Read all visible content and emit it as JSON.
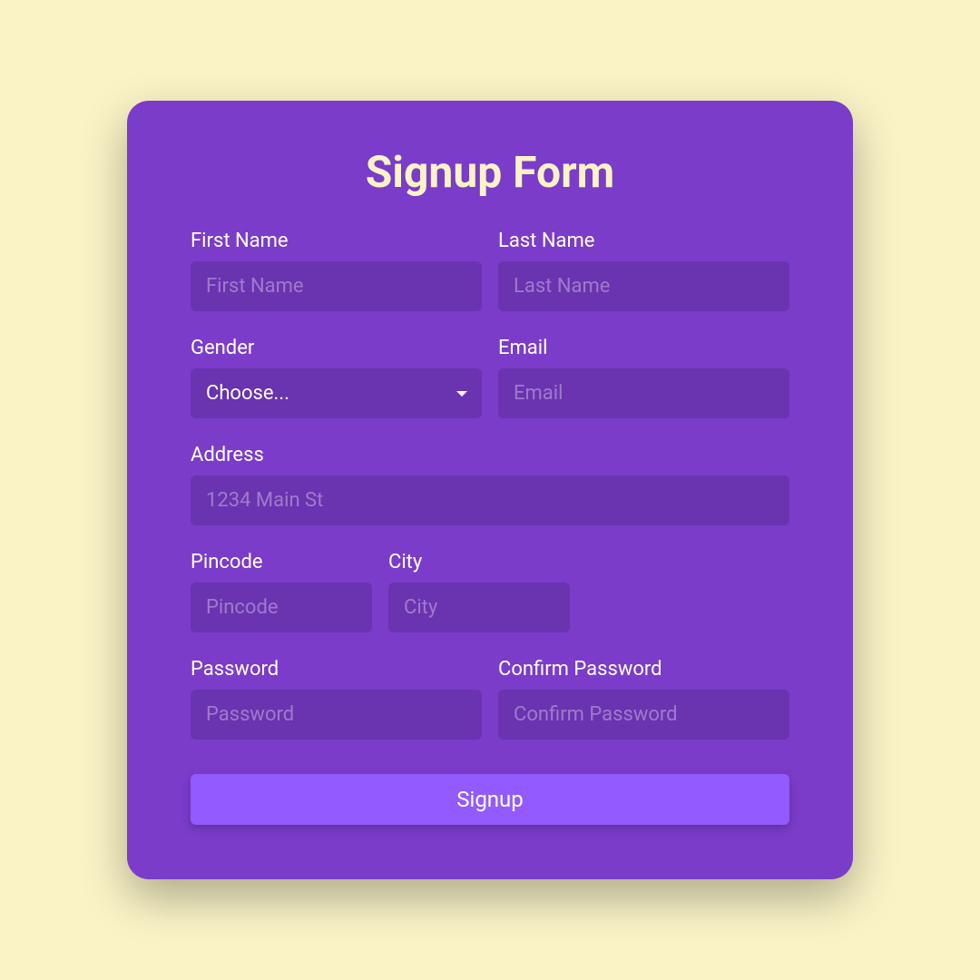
{
  "form": {
    "title": "Signup Form",
    "firstName": {
      "label": "First Name",
      "placeholder": "First Name",
      "value": ""
    },
    "lastName": {
      "label": "Last Name",
      "placeholder": "Last Name",
      "value": ""
    },
    "gender": {
      "label": "Gender",
      "selected": "Choose..."
    },
    "email": {
      "label": "Email",
      "placeholder": "Email",
      "value": ""
    },
    "address": {
      "label": "Address",
      "placeholder": "1234 Main St",
      "value": ""
    },
    "pincode": {
      "label": "Pincode",
      "placeholder": "Pincode",
      "value": ""
    },
    "city": {
      "label": "City",
      "placeholder": "City",
      "value": ""
    },
    "password": {
      "label": "Password",
      "placeholder": "Password",
      "value": ""
    },
    "confirmPassword": {
      "label": "Confirm Password",
      "placeholder": "Confirm Password",
      "value": ""
    },
    "submitLabel": "Signup"
  }
}
